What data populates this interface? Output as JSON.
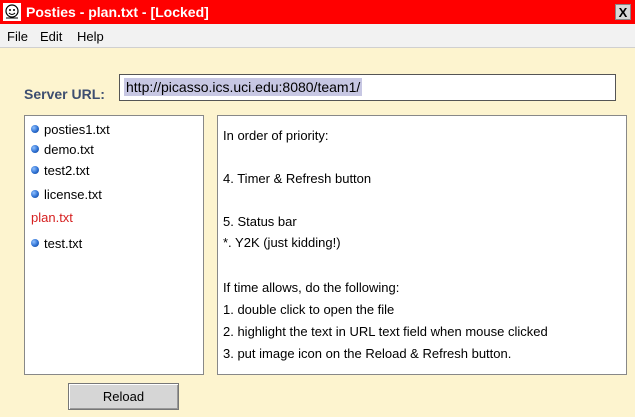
{
  "window": {
    "title": "Posties - plan.txt - [Locked]",
    "close_glyph": "X",
    "title_bar_color": "#ff0000",
    "background_color": "#fdf4cf"
  },
  "menu": {
    "items": [
      "File",
      "Edit",
      "Help"
    ]
  },
  "server": {
    "label": "Server URL:",
    "url": "http://picasso.ics.uci.edu:8080/team1/"
  },
  "files": {
    "items": [
      {
        "name": "posties1.txt",
        "icon": "blue-bullet-icon",
        "selected": false
      },
      {
        "name": "demo.txt",
        "icon": "blue-bullet-icon",
        "selected": false
      },
      {
        "name": "test2.txt",
        "icon": "blue-bullet-icon",
        "selected": false
      },
      {
        "name": "license.txt",
        "icon": "blue-bullet-icon",
        "selected": false
      },
      {
        "name": "plan.txt",
        "icon": "",
        "selected": true
      },
      {
        "name": "test.txt",
        "icon": "blue-bullet-icon",
        "selected": false
      }
    ],
    "selected_color": "#d62020"
  },
  "document": {
    "lines": [
      "In order of priority:",
      "",
      "4. Timer & Refresh button",
      "",
      "5. Status bar",
      "*. Y2K (just kidding!)",
      "",
      "If time allows, do the following:",
      "1. double click to open the file",
      "2. highlight the text in URL text field when mouse clicked",
      "3. put image icon on the Reload & Refresh button."
    ]
  },
  "actions": {
    "reload_label": "Reload"
  }
}
